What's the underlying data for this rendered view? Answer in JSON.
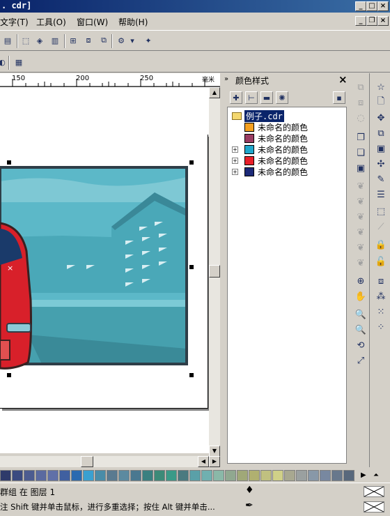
{
  "window": {
    "title": ". cdr]",
    "outer_controls": [
      "_",
      "□",
      "×"
    ],
    "inner_controls": [
      "_",
      "❐",
      "×"
    ]
  },
  "menu": [
    {
      "label": "文字(T)"
    },
    {
      "label": "工具(O)"
    },
    {
      "label": "窗口(W)"
    },
    {
      "label": "帮助(H)"
    }
  ],
  "ruler": {
    "labels": [
      "150",
      "200",
      "250"
    ],
    "unit": "毫米"
  },
  "docker": {
    "title": "颜色样式",
    "tree": [
      {
        "label": "例子.cdr",
        "type": "folder",
        "selected": true,
        "expander": false
      },
      {
        "label": "未命名的颜色",
        "color": "#f5a020",
        "expander": false
      },
      {
        "label": "未命名的颜色",
        "color": "#9a3c62",
        "expander": false
      },
      {
        "label": "未命名的颜色",
        "color": "#1fa7cc",
        "expander": true
      },
      {
        "label": "未命名的颜色",
        "color": "#e8202a",
        "expander": true
      },
      {
        "label": "未命名的颜色",
        "color": "#1c2a78",
        "expander": true
      }
    ]
  },
  "palette": [
    "#2e3a6a",
    "#3a4a80",
    "#4c5c90",
    "#5a6aa0",
    "#6070a8",
    "#4060a0",
    "#2a6ab0",
    "#3aa0d0",
    "#4a8ca8",
    "#5a7a90",
    "#5c8aa0",
    "#4a7890",
    "#3a8080",
    "#3c8a78",
    "#3a9a88",
    "#4a7a80",
    "#5aa0a8",
    "#70b0b0",
    "#8ab8a8",
    "#90a890",
    "#a0a878",
    "#b0b070",
    "#c0c080",
    "#d0d088",
    "#a8a890",
    "#9aa0a0",
    "#8898a8",
    "#7888a0",
    "#68788c",
    "#58687c"
  ],
  "status": {
    "line1": "群组 在 图层 1",
    "line2": "注 Shift 键并单击鼠标，进行多重选择；按住 Alt 键并单击..."
  }
}
